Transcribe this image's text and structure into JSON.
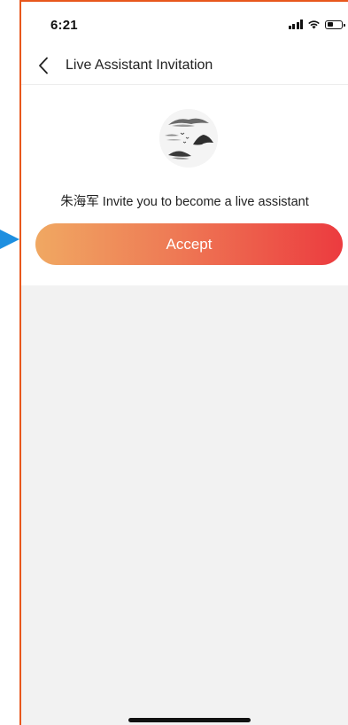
{
  "status_bar": {
    "time": "6:21"
  },
  "nav": {
    "back_icon": "chevron-left-icon",
    "title": "Live Assistant Invitation"
  },
  "invitation": {
    "avatar_icon": "ink-landscape-avatar",
    "message": "朱海军 Invite you to become a live assistant",
    "accept_label": "Accept"
  },
  "colors": {
    "frame": "#e8571c",
    "accept_gradient_start": "#f0a862",
    "accept_gradient_end": "#ec3b3f",
    "background_gray": "#f2f2f2",
    "pointer": "#1e8fe0"
  }
}
